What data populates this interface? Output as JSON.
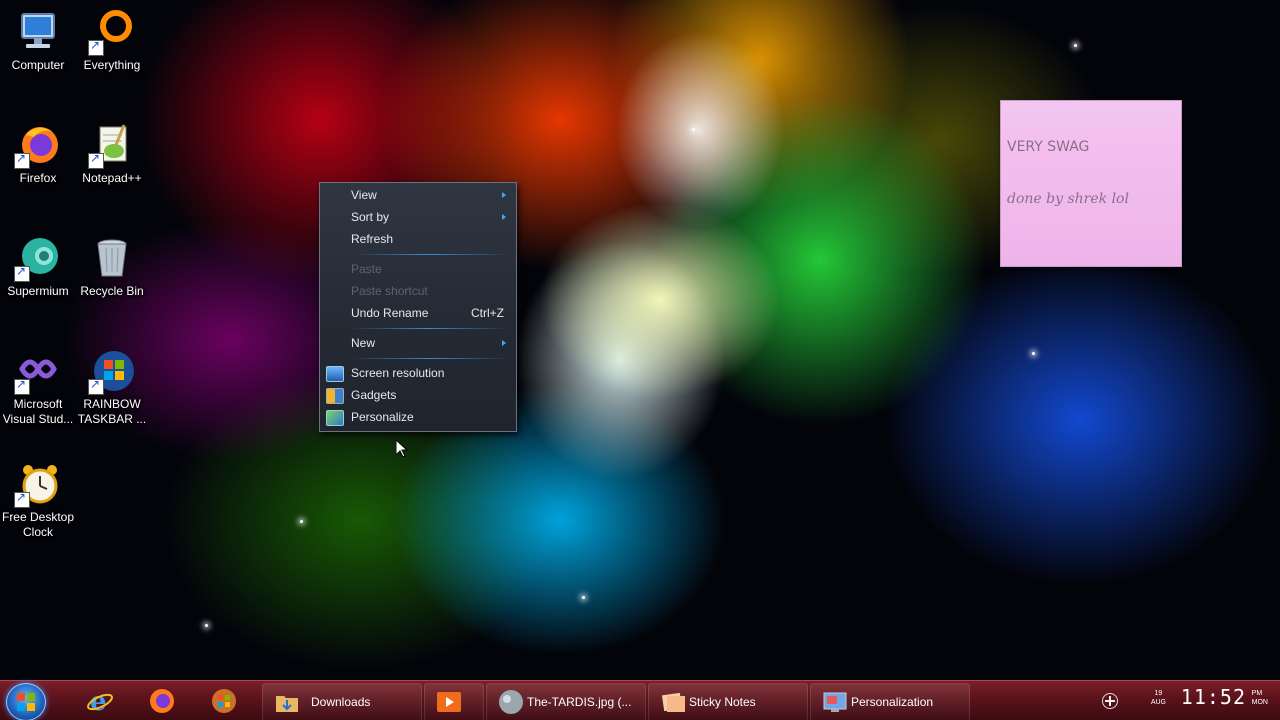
{
  "desktop": {
    "icons": [
      {
        "label": "Computer",
        "icon": "computer-icon"
      },
      {
        "label": "Everything",
        "icon": "everything-icon"
      },
      {
        "label": "Firefox",
        "icon": "firefox-icon"
      },
      {
        "label": "Notepad++",
        "icon": "notepad-plus-plus-icon"
      },
      {
        "label": "Supermium",
        "icon": "supermium-icon"
      },
      {
        "label": "Recycle Bin",
        "icon": "recycle-bin-icon"
      },
      {
        "label": "Microsoft Visual Stud...",
        "icon": "visual-studio-icon"
      },
      {
        "label": "RAINBOW TASKBAR ...",
        "icon": "windows-logo-icon"
      },
      {
        "label": "Free Desktop Clock",
        "icon": "alarm-clock-icon"
      }
    ]
  },
  "sticky_note": {
    "line1": "VERY SWAG",
    "line2": "done by shrek lol",
    "color": "#f2c2ee"
  },
  "context_menu": {
    "items": [
      {
        "label": "View",
        "submenu": true,
        "disabled": false
      },
      {
        "label": "Sort by",
        "submenu": true,
        "disabled": false
      },
      {
        "label": "Refresh",
        "submenu": false,
        "disabled": false
      },
      {
        "label": "Paste",
        "submenu": false,
        "disabled": true
      },
      {
        "label": "Paste shortcut",
        "submenu": false,
        "disabled": true
      },
      {
        "label": "Undo Rename",
        "shortcut": "Ctrl+Z",
        "submenu": false,
        "disabled": false
      },
      {
        "label": "New",
        "submenu": true,
        "disabled": false
      },
      {
        "label": "Screen resolution",
        "icon": "screen-resolution-icon"
      },
      {
        "label": "Gadgets",
        "icon": "gadgets-icon"
      },
      {
        "label": "Personalize",
        "icon": "personalize-icon"
      }
    ]
  },
  "taskbar": {
    "start_icon": "start-orb-icon",
    "pinned": [
      {
        "icon": "internet-explorer-icon"
      },
      {
        "icon": "firefox-icon"
      },
      {
        "icon": "windows-media-icon"
      }
    ],
    "windows": [
      {
        "label": "Downloads",
        "icon": "folder-icon"
      },
      {
        "label": "",
        "icon": "media-player-icon"
      },
      {
        "label": "The-TARDIS.jpg (...",
        "icon": "image-viewer-icon"
      },
      {
        "label": "Sticky Notes",
        "icon": "sticky-notes-icon"
      },
      {
        "label": "Personalization",
        "icon": "personalization-icon"
      }
    ],
    "tray": {
      "date_day": "19",
      "date_month": "AUG",
      "time": "11:52",
      "ampm": "PM",
      "weekday": "MON"
    },
    "colors": {
      "taskbar": "#5a121a",
      "accent": "#3a8ad6"
    }
  }
}
